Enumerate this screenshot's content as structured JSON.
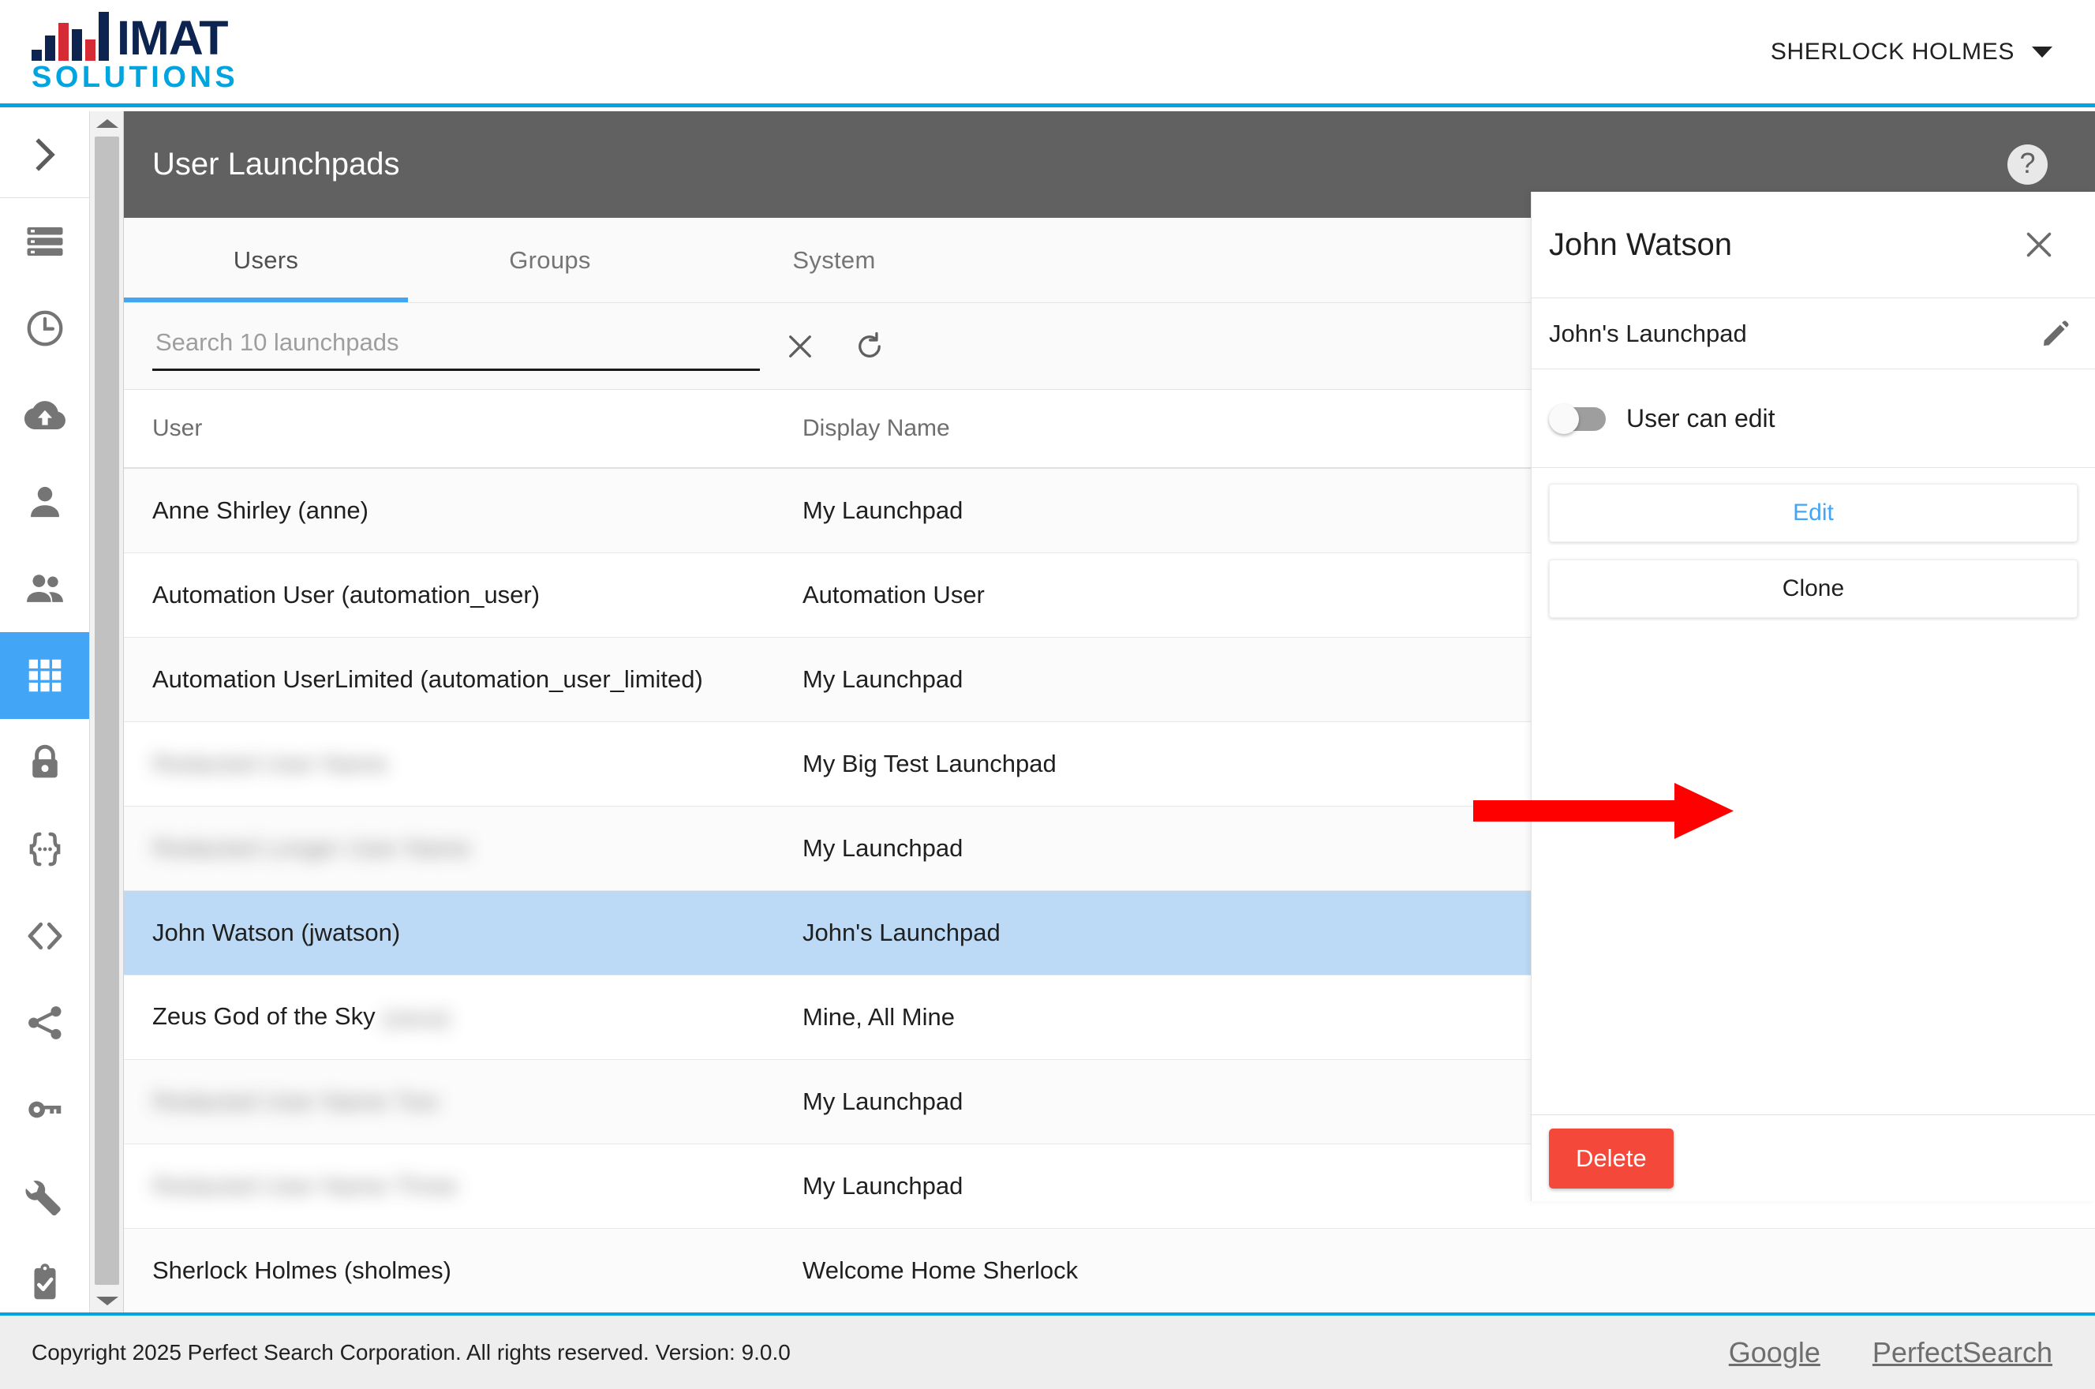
{
  "topbar": {
    "logo_primary": "IMAT",
    "logo_secondary": "SOLUTIONS",
    "user_name": "SHERLOCK HOLMES"
  },
  "colors": {
    "brand_blue": "#00a5df",
    "accent_blue": "#42a5f5",
    "logo_navy": "#0d2350",
    "logo_red": "#d52b35",
    "header_gray": "#616161",
    "selected_row": "#bcd9f5",
    "delete_red": "#f4483b",
    "annotation_red": "#ff0000"
  },
  "sidebar": {
    "expand_label": "chevron-right",
    "items": [
      {
        "icon": "storage-icon",
        "active": false
      },
      {
        "icon": "clock-icon",
        "active": false
      },
      {
        "icon": "cloud-upload-icon",
        "active": false
      },
      {
        "icon": "person-icon",
        "active": false
      },
      {
        "icon": "people-icon",
        "active": false
      },
      {
        "icon": "apps-grid-icon",
        "active": true
      },
      {
        "icon": "lock-icon",
        "active": false
      },
      {
        "icon": "braces-icon",
        "active": false
      },
      {
        "icon": "code-icon",
        "active": false
      },
      {
        "icon": "share-icon",
        "active": false
      },
      {
        "icon": "key-icon",
        "active": false
      },
      {
        "icon": "wrench-icon",
        "active": false
      },
      {
        "icon": "clipboard-check-icon",
        "active": false
      }
    ]
  },
  "page": {
    "title": "User Launchpads",
    "help_glyph": "?"
  },
  "tabs": [
    {
      "label": "Users",
      "active": true
    },
    {
      "label": "Groups",
      "active": false
    },
    {
      "label": "System",
      "active": false
    }
  ],
  "search": {
    "placeholder": "Search 10 launchpads",
    "value": "",
    "clear_icon": "close-icon",
    "refresh_icon": "refresh-icon"
  },
  "table": {
    "headers": {
      "user": "User",
      "display_name": "Display Name",
      "user_flag": "User"
    },
    "rows": [
      {
        "user": "Anne Shirley (anne)",
        "blurred": false,
        "display_name": "My Launchpad",
        "flag": false,
        "selected": false
      },
      {
        "user": "Automation User (automation_user)",
        "blurred": false,
        "display_name": "Automation User",
        "flag": true,
        "selected": false
      },
      {
        "user": "Automation UserLimited (automation_user_limited)",
        "blurred": false,
        "display_name": "My Launchpad",
        "flag": false,
        "selected": false
      },
      {
        "user": "Redacted User Name",
        "blurred": true,
        "display_name": "My Big Test Launchpad",
        "flag": true,
        "selected": false
      },
      {
        "user": "Redacted Longer User Name",
        "blurred": true,
        "display_name": "My Launchpad",
        "flag": true,
        "selected": false
      },
      {
        "user": "John Watson (jwatson)",
        "blurred": false,
        "display_name": "John's Launchpad",
        "flag": false,
        "selected": true
      },
      {
        "user": "Zeus God of the Sky",
        "user_suffix_blurred": "(zeus)",
        "blurred": false,
        "inline_blur": true,
        "display_name": "Mine, All Mine",
        "flag": true,
        "selected": false
      },
      {
        "user": "Redacted User Name Two",
        "blurred": true,
        "display_name": "My Launchpad",
        "flag": true,
        "selected": false
      },
      {
        "user": "Redacted User Name Three",
        "blurred": true,
        "display_name": "My Launchpad",
        "flag": true,
        "selected": false
      },
      {
        "user": "Sherlock Holmes (sholmes)",
        "blurred": false,
        "display_name": "Welcome Home Sherlock",
        "flag": false,
        "selected": false,
        "clipped": true
      }
    ]
  },
  "detail": {
    "title": "John Watson",
    "close_icon": "close-icon",
    "launchpad_name": "John's Launchpad",
    "edit_pencil_icon": "pencil-icon",
    "toggle_label": "User can edit",
    "toggle_on": false,
    "edit_label": "Edit",
    "clone_label": "Clone",
    "delete_label": "Delete"
  },
  "annotation": {
    "arrow_target": "Clone",
    "color": "#ff0000"
  },
  "footer": {
    "copyright": "Copyright 2025 Perfect Search Corporation. All rights reserved. Version: 9.0.0",
    "links": [
      {
        "label": "Google"
      },
      {
        "label": "PerfectSearch"
      }
    ]
  }
}
